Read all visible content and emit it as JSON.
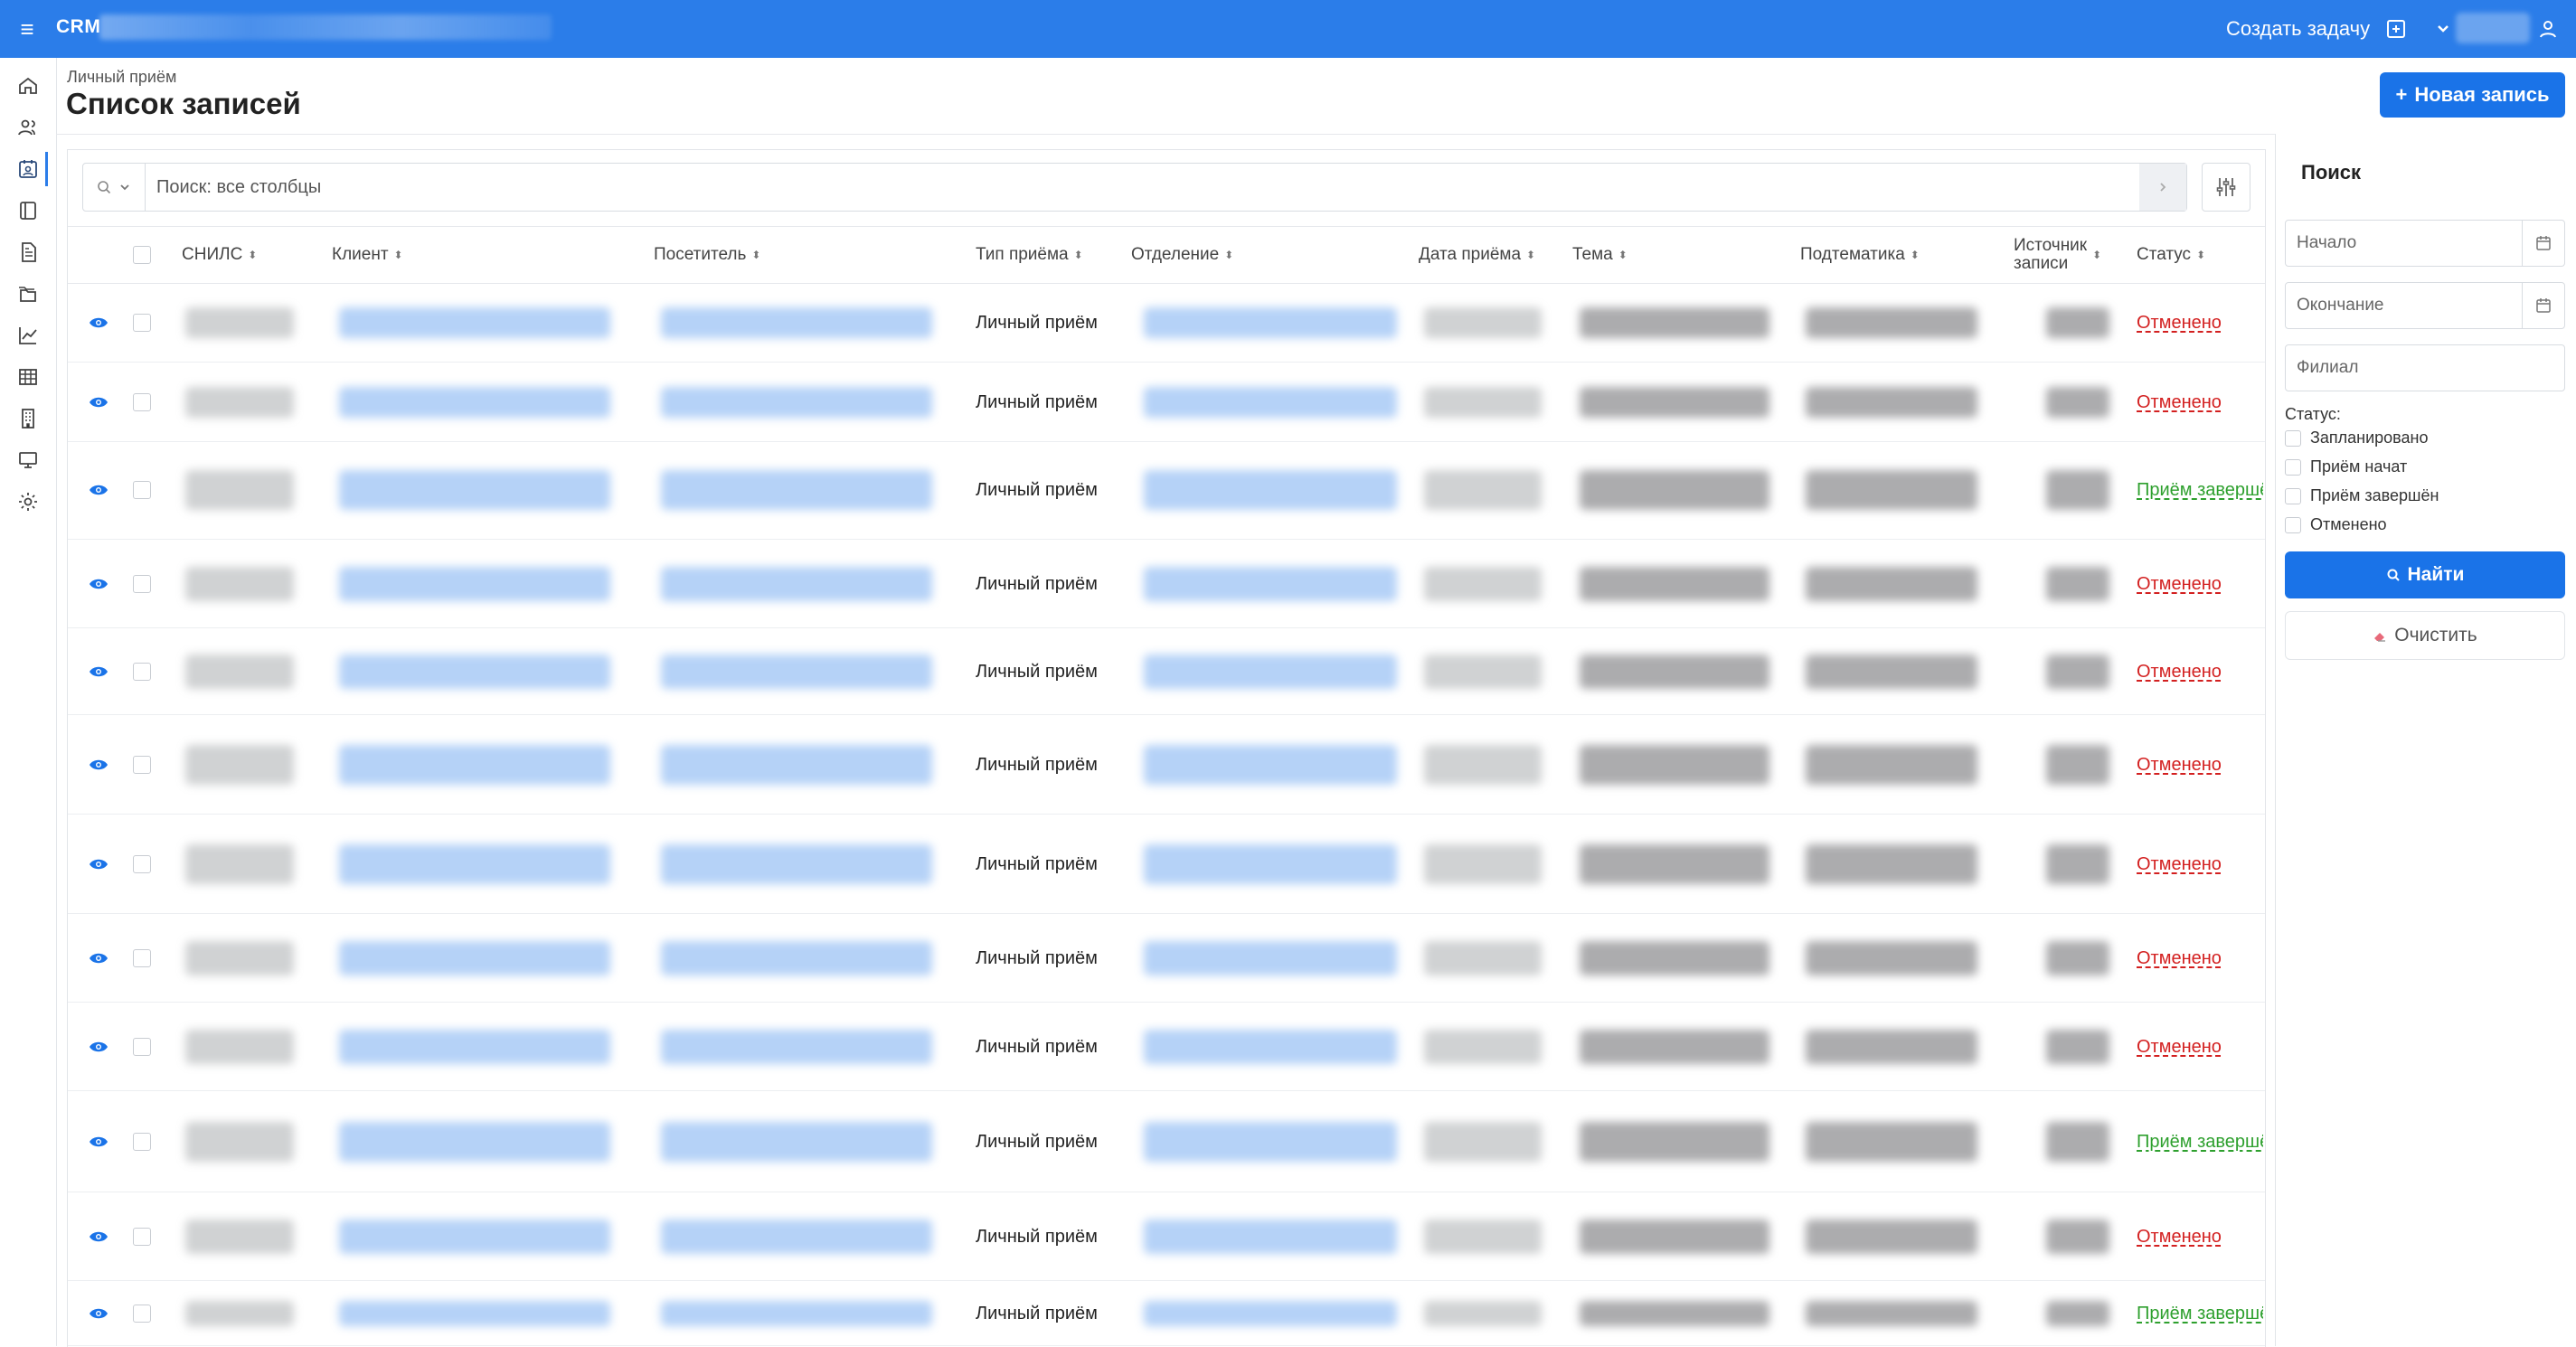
{
  "topbar": {
    "app_title": "CRM",
    "create_task": "Создать задачу",
    "accent": "#2b7de9"
  },
  "header": {
    "breadcrumb": "Личный приём",
    "title": "Список записей",
    "new_record_label": "Новая запись"
  },
  "search": {
    "placeholder": "Поиск: все столбцы"
  },
  "table": {
    "columns": [
      "СНИЛС",
      "Клиент",
      "Посетитель",
      "Тип приёма",
      "Отделение",
      "Дата приёма",
      "Тема",
      "Подтематика",
      "Источник записи",
      "Статус"
    ],
    "rows": [
      {
        "type": "Личный приём",
        "status": "Отменено",
        "status_kind": "cancel"
      },
      {
        "type": "Личный приём",
        "status": "Отменено",
        "status_kind": "cancel"
      },
      {
        "type": "Личный приём",
        "status": "Приём завершён",
        "status_kind": "done"
      },
      {
        "type": "Личный приём",
        "status": "Отменено",
        "status_kind": "cancel"
      },
      {
        "type": "Личный приём",
        "status": "Отменено",
        "status_kind": "cancel"
      },
      {
        "type": "Личный приём",
        "status": "Отменено",
        "status_kind": "cancel"
      },
      {
        "type": "Личный приём",
        "status": "Отменено",
        "status_kind": "cancel"
      },
      {
        "type": "Личный приём",
        "status": "Отменено",
        "status_kind": "cancel"
      },
      {
        "type": "Личный приём",
        "status": "Отменено",
        "status_kind": "cancel"
      },
      {
        "type": "Личный приём",
        "status": "Приём завершён",
        "status_kind": "done"
      },
      {
        "type": "Личный приём",
        "status": "Отменено",
        "status_kind": "cancel"
      },
      {
        "type": "Личный приём",
        "status": "Приём завершён",
        "status_kind": "done"
      }
    ]
  },
  "search_panel": {
    "title": "Поиск",
    "start_placeholder": "Начало",
    "end_placeholder": "Окончание",
    "branch_placeholder": "Филиал",
    "status_label": "Статус:",
    "status_options": [
      "Запланировано",
      "Приём начат",
      "Приём завершён",
      "Отменено"
    ],
    "find_label": "Найти",
    "clear_label": "Очистить"
  },
  "colors": {
    "primary_button": "#1a73e8",
    "status_cancel": "#d32020",
    "status_done": "#2ea02e"
  }
}
